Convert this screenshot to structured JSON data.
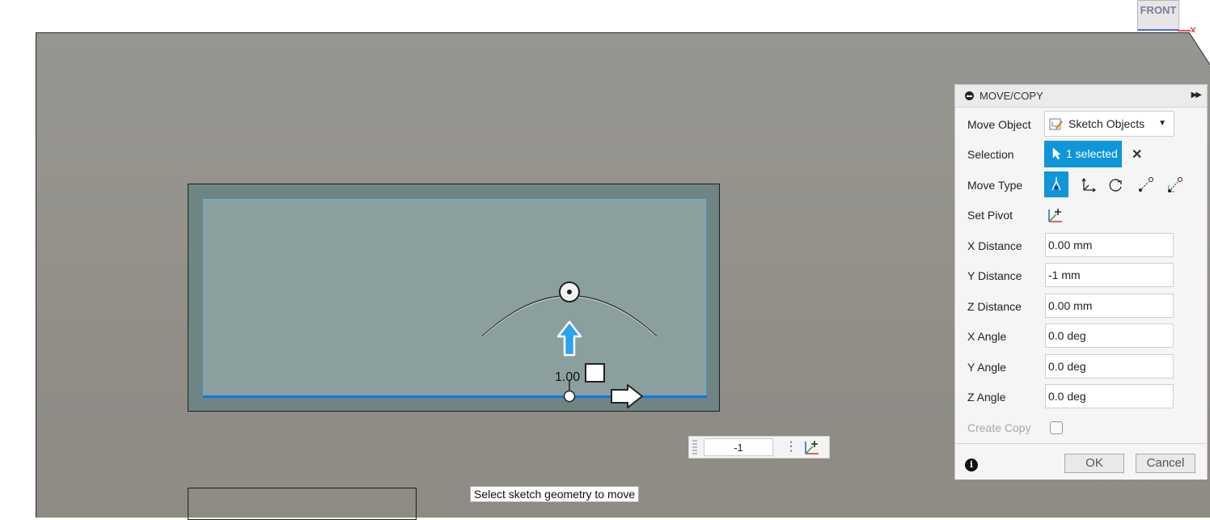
{
  "viewcube": {
    "label": "FRONT",
    "axis_label": "X"
  },
  "canvas": {
    "dimension_value": "1.00",
    "mini_toolbar_value": "-1",
    "status_tip": "Select sketch geometry to move"
  },
  "panel": {
    "title": "MOVE/COPY",
    "move_object": {
      "label": "Move Object",
      "value": "Sketch Objects"
    },
    "selection": {
      "label": "Selection",
      "value": "1 selected"
    },
    "move_type": {
      "label": "Move Type"
    },
    "set_pivot": {
      "label": "Set Pivot"
    },
    "fields": [
      {
        "label": "X Distance",
        "value": "0.00 mm"
      },
      {
        "label": "Y Distance",
        "value": "-1 mm"
      },
      {
        "label": "Z Distance",
        "value": "0.00 mm"
      },
      {
        "label": "X Angle",
        "value": "0.0 deg"
      },
      {
        "label": "Y Angle",
        "value": "0.0 deg"
      },
      {
        "label": "Z Angle",
        "value": "0.0 deg"
      }
    ],
    "create_copy": {
      "label": "Create Copy",
      "checked": false
    },
    "ok_label": "OK",
    "cancel_label": "Cancel"
  },
  "colors": {
    "accent": "#0f96d8",
    "selection_edge": "#0e77e8",
    "viewport": "#94928b"
  },
  "icons": [
    "viewcube-icon",
    "move-arrow-icon",
    "rotate-handle-icon",
    "pivot-icon",
    "info-icon",
    "cursor-icon",
    "close-icon"
  ]
}
